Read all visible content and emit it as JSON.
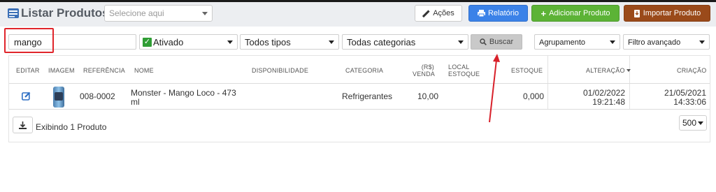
{
  "header": {
    "title": "Listar Produtos",
    "selector_placeholder": "Selecione aqui",
    "buttons": {
      "acoes": "Ações",
      "relatorio": "Relatório",
      "adicionar": "Adicionar Produto",
      "importar": "Importar Produto"
    }
  },
  "filters": {
    "search_value": "mango",
    "status": "Ativado",
    "tipos": "Todos tipos",
    "categorias": "Todas categorias",
    "buscar": "Buscar",
    "agrupamento": "Agrupamento",
    "filtro": "Filtro avançado"
  },
  "table": {
    "columns": {
      "editar": "EDITAR",
      "imagem": "IMAGEM",
      "referencia": "REFERÊNCIA",
      "nome": "NOME",
      "disponibilidade": "DISPONIBILIDADE",
      "categoria": "CATEGORIA",
      "venda_line1": "(R$)",
      "venda_line2": "VENDA",
      "local_line1": "LOCAL",
      "local_line2": "ESTOQUE",
      "estoque": "ESTOQUE",
      "alteracao": "ALTERAÇÃO",
      "criacao": "CRIAÇÃO"
    },
    "rows": [
      {
        "referencia": "008-0002",
        "nome_line1": "Monster - Mango Loco - 473",
        "nome_line2": "ml",
        "categoria": "Refrigerantes",
        "venda": "10,00",
        "estoque": "0,000",
        "alteracao_date": "01/02/2022",
        "alteracao_time": "19:21:48",
        "criacao_date": "21/05/2021",
        "criacao_time": "14:33:06"
      }
    ]
  },
  "footer": {
    "exibindo": "Exibindo 1 Produto",
    "page_size": "500"
  },
  "colors": {
    "relatorio": "#3b82e8",
    "adicionar": "#5cb336",
    "importar": "#9a4a1a",
    "highlight": "#e0252b"
  }
}
